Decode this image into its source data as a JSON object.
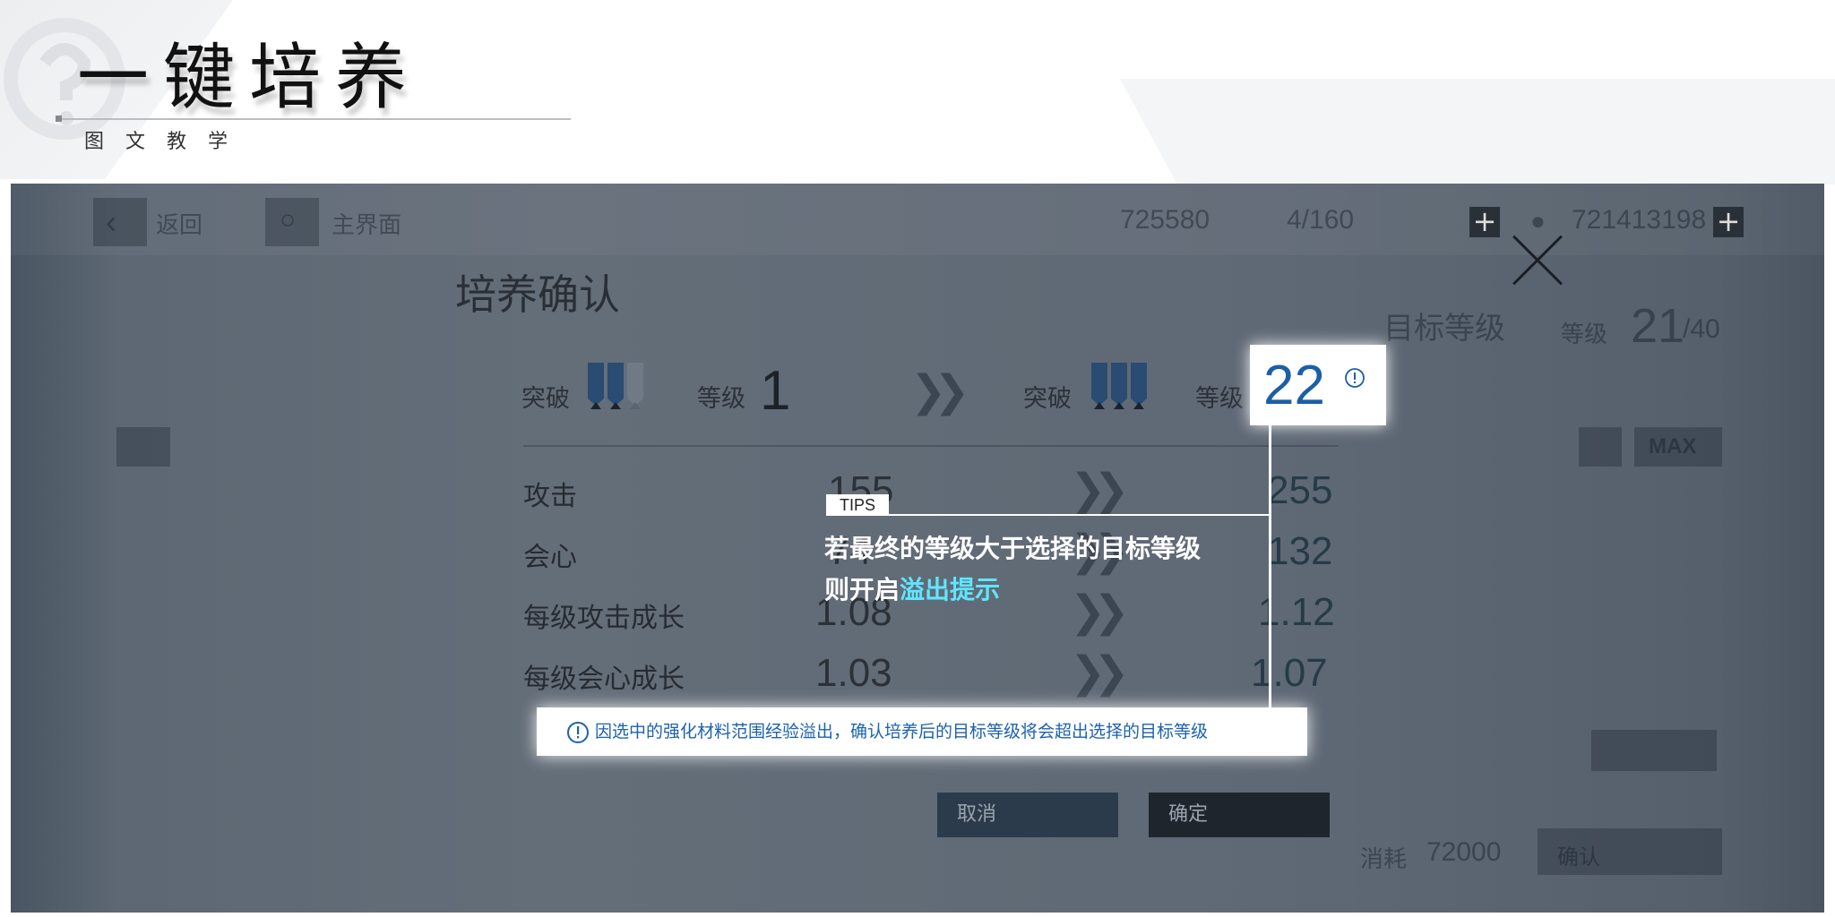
{
  "header": {
    "title": "一键培养",
    "subtitle": "图文教学"
  },
  "topbar": {
    "back_label": "返回",
    "home_label": "主界面",
    "currency_1": "725580",
    "currency_2": "721413198",
    "stamina": "4/160"
  },
  "side": {
    "target_level_label": "目标等级",
    "level_prefix": "等级",
    "level_value": "21",
    "level_max": "/40",
    "max_label": "MAX",
    "cost_label": "消耗",
    "cost_value": "72000",
    "confirm_side": "确认"
  },
  "dialog": {
    "title": "培养确认",
    "breakthrough_label": "突破",
    "level_label": "等级",
    "level_from": "1",
    "level_to": "22",
    "stats": [
      {
        "name": "攻击",
        "from": "155",
        "to": "255"
      },
      {
        "name": "会心",
        "from": "74",
        "to": "132"
      },
      {
        "name": "每级攻击成长",
        "from": "1.08",
        "to": "1.12"
      },
      {
        "name": "每级会心成长",
        "from": "1.03",
        "to": "1.07"
      }
    ],
    "cancel_label": "取消",
    "confirm_label": "确定"
  },
  "tips": {
    "tag": "TIPS",
    "line1": "若最终的等级大于选择的目标等级",
    "line2_prefix": "则开启",
    "line2_highlight": "溢出提示"
  },
  "warning": {
    "text": "因选中的强化材料范围经验溢出，确认培养后的目标等级将会超出选择的目标等级"
  },
  "colors": {
    "accent_blue": "#1b5fa8",
    "highlight_cyan": "#5fe6ff",
    "overlay_bg": "#5f6975"
  }
}
